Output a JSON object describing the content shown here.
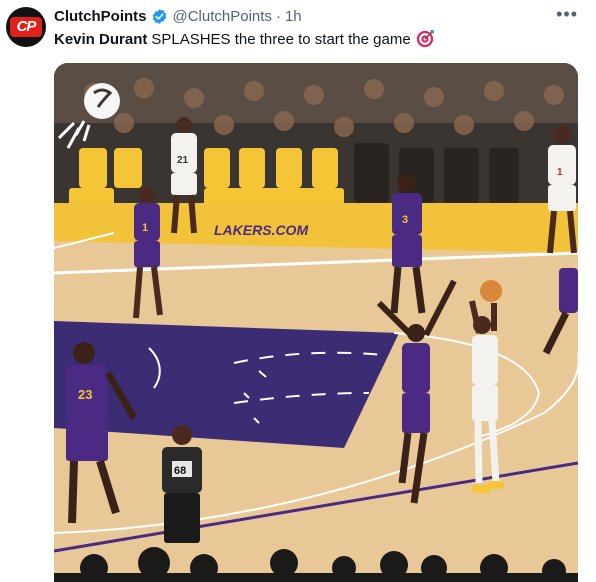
{
  "author": {
    "display_name": "ClutchPoints",
    "handle": "@ClutchPoints",
    "time": "1h",
    "avatar_text": "CP",
    "verified": true
  },
  "tweet": {
    "highlight": "Kevin Durant",
    "text": "SPLASHES the three to start the game",
    "emoji": "target-emoji"
  },
  "media": {
    "court_text": "LAKERS.COM",
    "jerseys": {
      "lakers_left": "1",
      "lakers_center": "3",
      "lakers_bottom": "23",
      "suns_left": "21",
      "suns_right": "1",
      "referee": "68"
    },
    "colors": {
      "lakers_purple": "#4b2a83",
      "lakers_gold": "#f4c534",
      "court_wood": "#e8c896",
      "paint": "#3b2c74"
    }
  },
  "icons": {
    "more": "more-icon",
    "verified": "verified-badge-icon",
    "suns_logo": "suns-logo-icon"
  }
}
